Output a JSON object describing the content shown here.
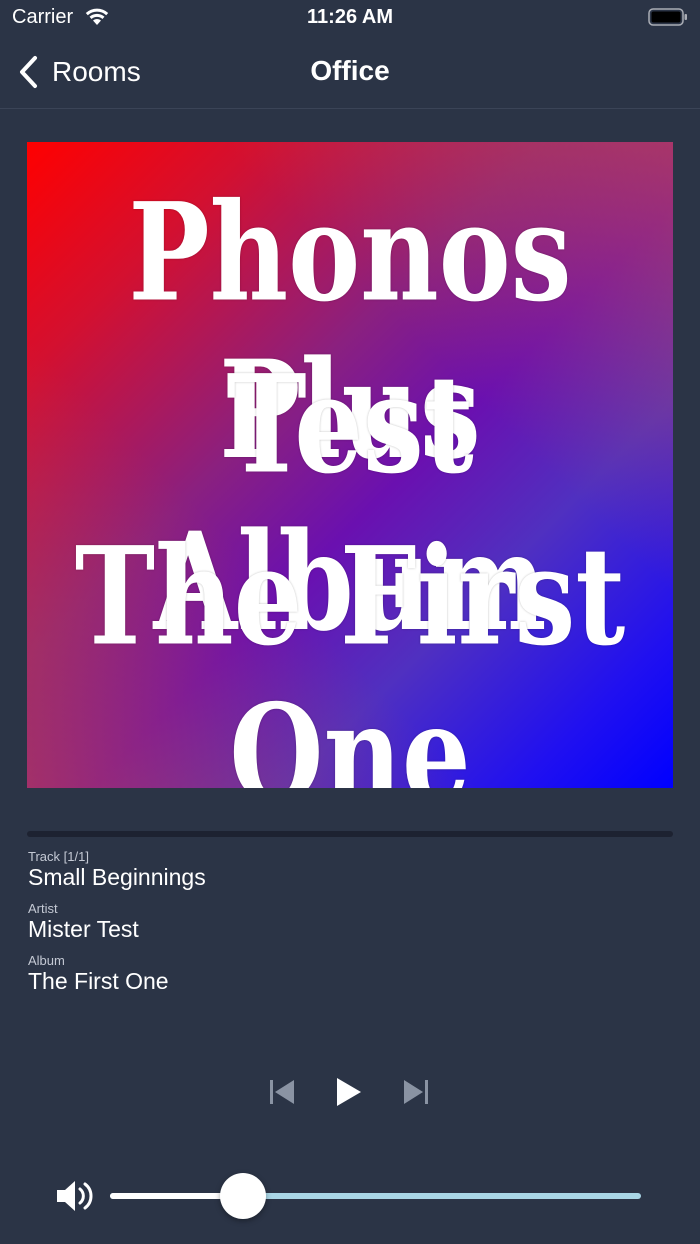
{
  "status_bar": {
    "carrier": "Carrier",
    "time": "11:26 AM",
    "icons": [
      "wifi-icon",
      "battery-icon"
    ]
  },
  "nav": {
    "back_label": "Rooms",
    "title": "Office",
    "back_icon": "chevron-left-icon"
  },
  "album_art": {
    "lines": [
      "Phonos Plus",
      "Test Album",
      "The First One"
    ],
    "gradient_colors": [
      "#ff0000",
      "#6a10b0",
      "#0000ff"
    ]
  },
  "progress": {
    "value": 0
  },
  "now_playing": {
    "track_label": "Track [1/1]",
    "track_value": "Small Beginnings",
    "artist_label": "Artist",
    "artist_value": "Mister Test",
    "album_label": "Album",
    "album_value": "The First One"
  },
  "controls": {
    "icons": [
      "previous-icon",
      "play-icon",
      "next-icon"
    ]
  },
  "volume": {
    "level": 0.25,
    "icon": "speaker-icon",
    "track_color": "#a9d6e6",
    "fill_color": "#ffffff"
  },
  "colors": {
    "background": "#2b3446",
    "progress_track": "#1d2231"
  }
}
